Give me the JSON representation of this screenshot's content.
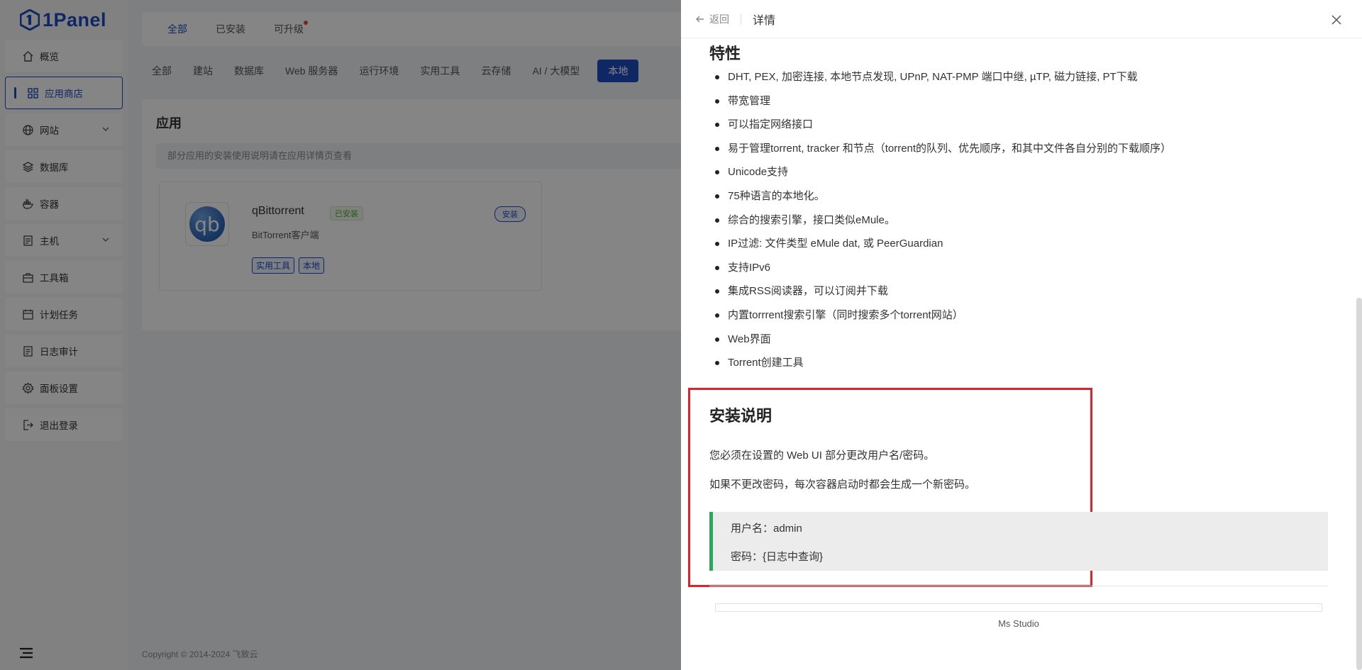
{
  "brand": {
    "name": "1Panel"
  },
  "sidebar": {
    "items": [
      {
        "label": "概览",
        "icon": "home-icon"
      },
      {
        "label": "应用商店",
        "icon": "apps-icon",
        "active": true
      },
      {
        "label": "网站",
        "icon": "globe-icon",
        "expandable": true
      },
      {
        "label": "数据库",
        "icon": "layers-icon"
      },
      {
        "label": "容器",
        "icon": "docker-icon"
      },
      {
        "label": "主机",
        "icon": "server-icon",
        "expandable": true
      },
      {
        "label": "工具箱",
        "icon": "toolbox-icon"
      },
      {
        "label": "计划任务",
        "icon": "calendar-icon"
      },
      {
        "label": "日志审计",
        "icon": "log-icon"
      },
      {
        "label": "面板设置",
        "icon": "gear-icon"
      },
      {
        "label": "退出登录",
        "icon": "logout-icon"
      }
    ]
  },
  "topbar": {
    "tabs": [
      "全部",
      "已安装",
      "可升级"
    ],
    "active": "全部"
  },
  "categories": {
    "items": [
      "全部",
      "建站",
      "数据库",
      "Web 服务器",
      "运行环境",
      "实用工具",
      "云存储",
      "AI / 大模型"
    ],
    "active_label": "本地"
  },
  "apps_panel": {
    "title": "应用",
    "notice": "部分应用的安装使用说明请在应用详情页查看",
    "card": {
      "name": "qBittorrent",
      "icon_text": "qb",
      "status": "已安装",
      "description": "BitTorrent客户端",
      "install_label": "安装",
      "tags": [
        "实用工具",
        "本地"
      ]
    }
  },
  "footer": {
    "copyright": "Copyright © 2014-2024 飞致云"
  },
  "drawer": {
    "back_label": "返回",
    "title": "详情",
    "features_heading": "特性",
    "features": [
      "DHT, PEX, 加密连接, 本地节点发现, UPnP, NAT-PMP 端口中继, µTP, 磁力链接, PT下载",
      "带宽管理",
      "可以指定网络接口",
      "易于管理torrent, tracker 和节点（torrent的队列、优先顺序，和其中文件各自分别的下载顺序）",
      "Unicode支持",
      "75种语言的本地化。",
      "综合的搜索引擎，接口类似eMule。",
      "IP过滤: 文件类型 eMule dat, 或 PeerGuardian",
      "支持IPv6",
      "集成RSS阅读器，可以订阅并下载",
      "内置torrrent搜索引擎（同时搜索多个torrent网站）",
      "Web界面",
      "Torrent创建工具"
    ],
    "install_heading": "安装说明",
    "install_paragraphs": [
      "您必须在设置的 Web UI 部分更改用户名/密码。",
      "如果不更改密码，每次容器启动时都会生成一个新密码。"
    ],
    "quote": {
      "username_line": "用户名：admin",
      "password_line": "密码：{日志中查询}"
    },
    "author": "Ms Studio"
  },
  "colors": {
    "brand": "#1f4bc4",
    "highlight_border": "#e0202a",
    "quote_accent": "#2ca85a",
    "installed_green": "#52a83a",
    "notification_dot": "#e5483d"
  }
}
